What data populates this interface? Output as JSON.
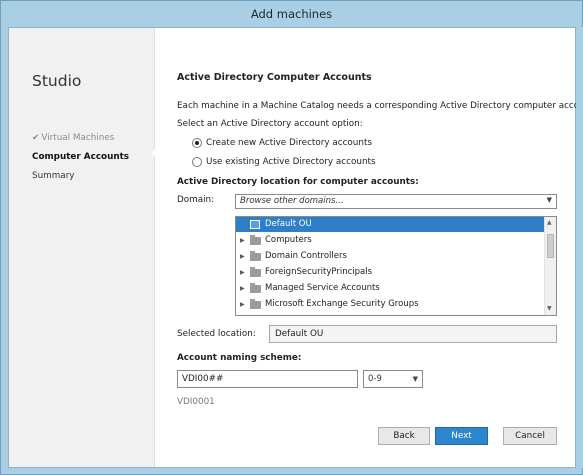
{
  "window": {
    "title": "Add machines"
  },
  "sidebar": {
    "app_name": "Studio",
    "steps": [
      {
        "label": "Virtual Machines",
        "state": "done"
      },
      {
        "label": "Computer Accounts",
        "state": "current"
      },
      {
        "label": "Summary",
        "state": "todo"
      }
    ]
  },
  "main": {
    "heading": "Active Directory Computer Accounts",
    "description": "Each machine in a Machine Catalog needs a corresponding Active Directory computer account.",
    "option_label": "Select an Active Directory account option:",
    "options": [
      {
        "label": "Create new Active Directory accounts",
        "selected": true
      },
      {
        "label": "Use existing Active Directory accounts",
        "selected": false
      }
    ],
    "location_label": "Active Directory location for computer accounts:",
    "domain_label": "Domain:",
    "domain_value": "Browse other domains...",
    "tree": [
      {
        "label": "Default OU",
        "selected": true,
        "icon": "ou-icon",
        "expandable": false
      },
      {
        "label": "Computers",
        "selected": false,
        "icon": "folder-icon",
        "expandable": true
      },
      {
        "label": "Domain Controllers",
        "selected": false,
        "icon": "folder-icon",
        "expandable": true
      },
      {
        "label": "ForeignSecurityPrincipals",
        "selected": false,
        "icon": "folder-icon",
        "expandable": true
      },
      {
        "label": "Managed Service Accounts",
        "selected": false,
        "icon": "folder-icon",
        "expandable": true
      },
      {
        "label": "Microsoft Exchange Security Groups",
        "selected": false,
        "icon": "folder-icon",
        "expandable": true
      }
    ],
    "selected_location_label": "Selected location:",
    "selected_location_value": "Default OU",
    "naming_label": "Account naming scheme:",
    "naming_value": "VDI00##",
    "naming_type": "0-9",
    "naming_preview": "VDI0001"
  },
  "buttons": {
    "back": "Back",
    "next": "Next",
    "cancel": "Cancel"
  },
  "colors": {
    "accent": "#2c86cd",
    "selection": "#2e7fc8",
    "frame": "#a9cfe4"
  }
}
